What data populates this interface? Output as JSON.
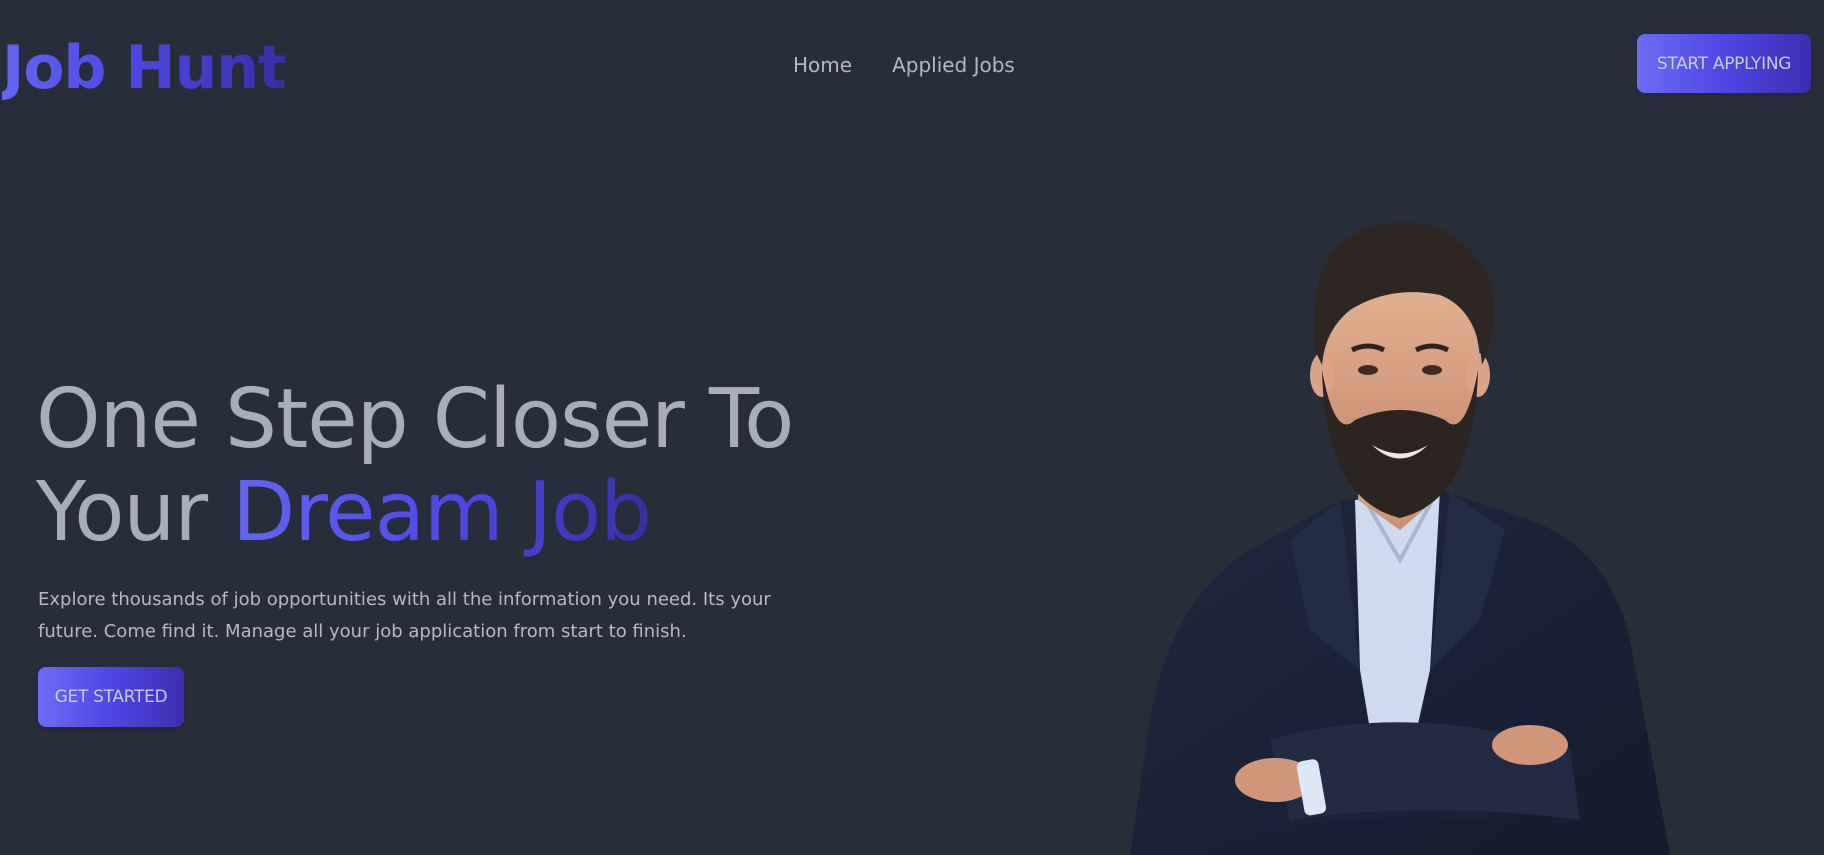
{
  "header": {
    "logo_text": "Job Hunt",
    "nav": [
      {
        "label": "Home"
      },
      {
        "label": "Applied Jobs"
      }
    ],
    "cta_label": "START APPLYING"
  },
  "hero": {
    "title_line1": "One Step Closer To",
    "title_line2_prefix": "Your ",
    "title_line2_accent": "Dream Job",
    "description": "Explore thousands of job opportunities with all the information you need. Its your future. Come find it. Manage all your job application from start to finish.",
    "button_label": "GET STARTED"
  },
  "colors": {
    "background": "#282d3a",
    "accent_start": "#6366f1",
    "accent_end": "#3730a3",
    "text_muted": "#a8adbd"
  },
  "image": {
    "icon": "person-photo-illustration"
  }
}
